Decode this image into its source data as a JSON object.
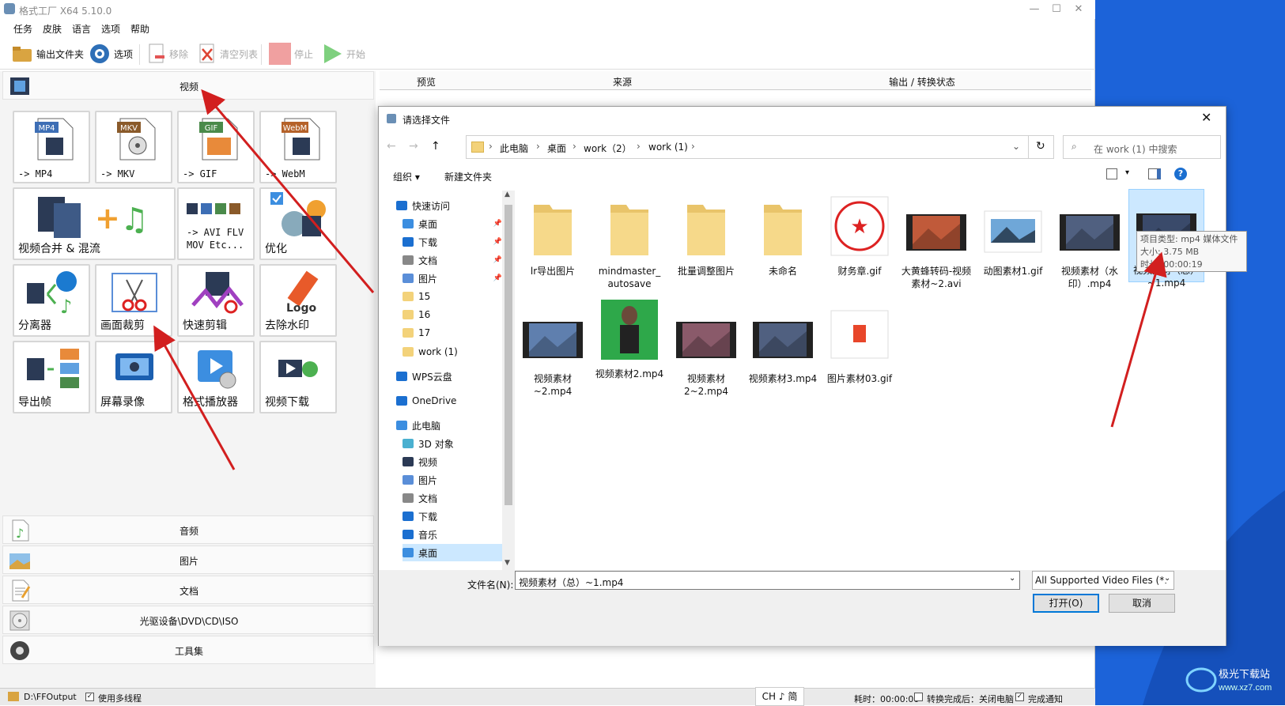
{
  "app": {
    "title": "格式工厂 X64 5.10.0",
    "menus": [
      "任务",
      "皮肤",
      "语言",
      "选项",
      "帮助"
    ],
    "toolbar": {
      "output_folder": "输出文件夹",
      "options": "选项",
      "remove": "移除",
      "clear_list": "清空列表",
      "stop": "停止",
      "start": "开始"
    },
    "categories": {
      "video": "视频",
      "audio": "音频",
      "image": "图片",
      "document": "文档",
      "disc": "光驱设备\\DVD\\CD\\ISO",
      "tools": "工具集"
    },
    "tiles": {
      "mp4": "-> MP4",
      "mkv": "-> MKV",
      "gif": "-> GIF",
      "webm": "-> WebM",
      "merge": "视频合并 & 混流",
      "avi_line1": "-> AVI FLV",
      "avi_line2": "MOV Etc...",
      "optimize": "优化",
      "splitter": "分离器",
      "crop": "画面裁剪",
      "quick_edit": "快速剪辑",
      "remove_watermark": "去除水印",
      "export_frames": "导出帧",
      "screen_record": "屏幕录像",
      "player": "格式播放器",
      "download": "视频下载"
    },
    "tile_badges": {
      "mp4": "MP4",
      "mkv": "MKV",
      "gif": "GIF",
      "webm": "WebM",
      "logo": "Logo"
    },
    "list_columns": [
      "预览",
      "来源",
      "输出 / 转换状态"
    ],
    "status": {
      "output_path": "D:\\FFOutput",
      "multithread": "使用多线程",
      "ime": "CH ♪ 简",
      "elapsed": "耗时：00:00:00",
      "after_convert": "转换完成后：关闭电脑",
      "notify": "完成通知"
    }
  },
  "dialog": {
    "title": "请选择文件",
    "breadcrumb": [
      "此电脑",
      "桌面",
      "work（2）",
      "work (1)"
    ],
    "search_placeholder": "在 work (1) 中搜索",
    "organize": "组织",
    "new_folder": "新建文件夹",
    "nav_items": [
      {
        "label": "快速访问",
        "icon": "star-icon"
      },
      {
        "label": "桌面",
        "icon": "desktop-icon"
      },
      {
        "label": "下载",
        "icon": "download-icon"
      },
      {
        "label": "文档",
        "icon": "document-icon"
      },
      {
        "label": "图片",
        "icon": "picture-icon"
      },
      {
        "label": "15",
        "icon": "folder-icon"
      },
      {
        "label": "16",
        "icon": "folder-icon"
      },
      {
        "label": "17",
        "icon": "folder-icon"
      },
      {
        "label": "work (1)",
        "icon": "folder-icon"
      },
      {
        "label": "WPS云盘",
        "icon": "cloud-icon"
      },
      {
        "label": "OneDrive",
        "icon": "cloud-icon"
      },
      {
        "label": "此电脑",
        "icon": "computer-icon"
      },
      {
        "label": "3D 对象",
        "icon": "cube-icon"
      },
      {
        "label": "视频",
        "icon": "video-icon"
      },
      {
        "label": "图片",
        "icon": "picture-icon"
      },
      {
        "label": "文档",
        "icon": "document-icon"
      },
      {
        "label": "下载",
        "icon": "download-icon"
      },
      {
        "label": "音乐",
        "icon": "music-icon"
      },
      {
        "label": "桌面",
        "icon": "desktop-icon"
      }
    ],
    "files": [
      {
        "name": "lr导出图片",
        "kind": "folder"
      },
      {
        "name": "mindmaster_ autosave",
        "kind": "folder"
      },
      {
        "name": "批量调整图片",
        "kind": "folder"
      },
      {
        "name": "未命名",
        "kind": "folder"
      },
      {
        "name": "财务章.gif",
        "kind": "stamp"
      },
      {
        "name": "大黄蜂转码-视频素材~2.avi",
        "kind": "video"
      },
      {
        "name": "动图素材1.gif",
        "kind": "image"
      },
      {
        "name": "视频素材（水印）.mp4",
        "kind": "video"
      },
      {
        "name": "视频素材（总）~1.mp4",
        "kind": "video"
      },
      {
        "name": "视频素材~2.mp4",
        "kind": "video"
      },
      {
        "name": "视频素材2.mp4",
        "kind": "greenscreen"
      },
      {
        "name": "视频素材2~2.mp4",
        "kind": "video"
      },
      {
        "name": "视频素材3.mp4",
        "kind": "video"
      },
      {
        "name": "图片素材03.gif",
        "kind": "office"
      }
    ],
    "tooltip": {
      "type": "项目类型: mp4 媒体文件",
      "size": "大小: 3.75 MB",
      "duration": "时长: 00:00:19"
    },
    "filename_label": "文件名(N):",
    "filename_value": "视频素材（总）~1.mp4",
    "filter": "All Supported Video Files (*.",
    "open": "打开(O)",
    "cancel": "取消"
  },
  "colors": {
    "accent": "#0078d7",
    "selection": "#cce8ff",
    "arrow": "#d21f1f",
    "desktop": "#1c63d9"
  }
}
